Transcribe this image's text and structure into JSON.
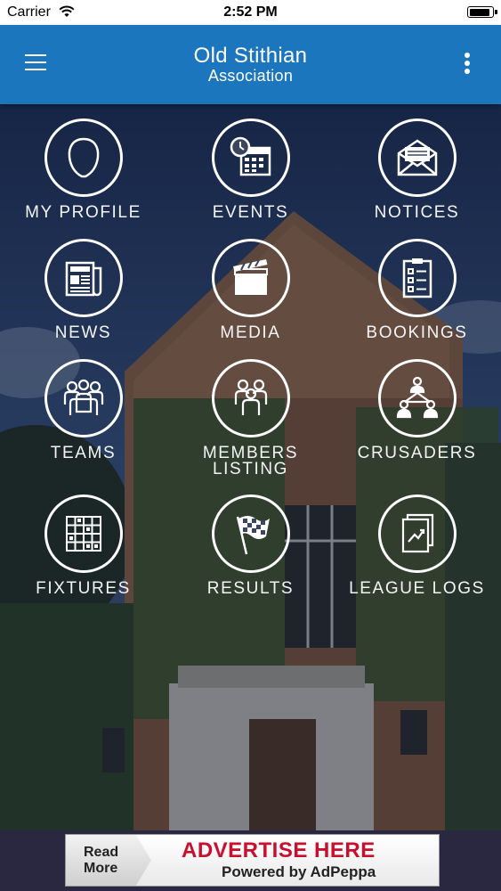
{
  "status_bar": {
    "carrier": "Carrier",
    "time": "2:52 PM",
    "icons": [
      "wifi-icon",
      "battery-icon"
    ]
  },
  "header": {
    "title_line1": "Old Stithian",
    "title_line2": "Association",
    "menu_icon": "hamburger-menu-icon",
    "more_icon": "vertical-ellipsis-icon",
    "color": "#1c76bd"
  },
  "tiles": [
    {
      "label": "MY PROFILE",
      "icon": "person-head-icon"
    },
    {
      "label": "EVENTS",
      "icon": "calendar-clock-icon"
    },
    {
      "label": "NOTICES",
      "icon": "open-envelope-icon"
    },
    {
      "label": "NEWS",
      "icon": "newspaper-icon"
    },
    {
      "label": "MEDIA",
      "icon": "clapperboard-icon"
    },
    {
      "label": "BOOKINGS",
      "icon": "clipboard-checklist-icon"
    },
    {
      "label": "TEAMS",
      "icon": "group-people-icon"
    },
    {
      "label": "MEMBERS\nLISTING",
      "icon": "members-crowd-icon"
    },
    {
      "label": "CRUSADERS",
      "icon": "network-people-icon"
    },
    {
      "label": "FIXTURES",
      "icon": "fixture-grid-icon"
    },
    {
      "label": "RESULTS",
      "icon": "checkered-flag-icon"
    },
    {
      "label": "LEAGUE LOGS",
      "icon": "trend-chart-document-icon"
    }
  ],
  "ad": {
    "read_more": "Read More",
    "headline": "ADVERTISE HERE",
    "subline": "Powered by AdPeppa",
    "headline_color": "#c8102e"
  }
}
